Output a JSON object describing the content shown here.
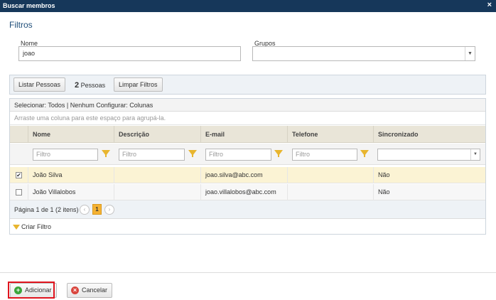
{
  "window": {
    "title": "Buscar membros",
    "close_glyph": "×"
  },
  "filters": {
    "title": "Filtros",
    "name_label": "Nome",
    "name_value": "joao",
    "groups_label": "Grupos",
    "groups_value": ""
  },
  "toolbar": {
    "list_people": "Listar Pessoas",
    "count": "2",
    "count_label": "Pessoas",
    "clear_filters": "Limpar Filtros"
  },
  "grid": {
    "links": "Selecionar: Todos | Nenhum   Configurar: Colunas",
    "group_hint": "Arraste uma coluna para este espaço para agrupá-la.",
    "columns": [
      "Nome",
      "Descrição",
      "E-mail",
      "Telefone",
      "Sincronizado"
    ],
    "filter_placeholder": "Filtro",
    "rows": [
      {
        "checked": "✔",
        "name": "João Silva",
        "description": "",
        "email": "joao.silva@abc.com",
        "phone": "",
        "synced": "Não"
      },
      {
        "checked": "",
        "name": "João Villalobos",
        "description": "",
        "email": "joao.villalobos@abc.com",
        "phone": "",
        "synced": "Não"
      }
    ],
    "pager": {
      "info": "Página 1 de 1 (2 itens)",
      "prev": "‹",
      "page": "1",
      "next": "›"
    },
    "create_filter": "Criar Filtro"
  },
  "footer": {
    "add": "Adicionar",
    "cancel": "Cancelar",
    "add_icon": "+",
    "cancel_icon": "×"
  },
  "colors": {
    "titlebar": "#16375a",
    "accent": "#f5b233",
    "highlight": "#e0141e"
  }
}
